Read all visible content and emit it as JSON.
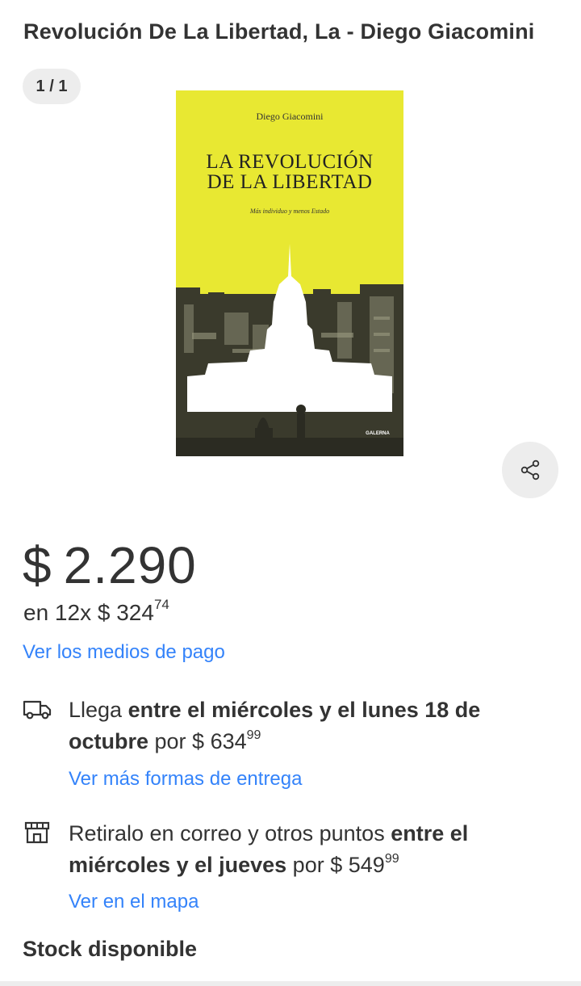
{
  "product": {
    "title": "Revolución De La Libertad, La - Diego Giacomini",
    "gallery_counter": "1 / 1"
  },
  "cover": {
    "author": "Diego Giacomini",
    "title_line1": "LA REVOLUCIÓN",
    "title_line2": "DE LA LIBERTAD",
    "subtitle": "Más individuo y menos Estado",
    "publisher": "GALERNA",
    "bg_color": "#e8e832"
  },
  "share": {
    "icon": "share-icon"
  },
  "price": {
    "currency": "$",
    "amount": "2.290"
  },
  "installments": {
    "prefix": "en 12x",
    "currency": "$",
    "amount": "324",
    "cents": "74"
  },
  "payment_link": "Ver los medios de pago",
  "shipping": {
    "icon": "truck-icon",
    "lead": "Llega ",
    "bold": "entre el miércoles y el lunes 18 de octubre",
    "mid": " por ",
    "currency": "$",
    "amount": "634",
    "cents": "99",
    "link": "Ver más formas de entrega"
  },
  "pickup": {
    "icon": "store-icon",
    "lead": "Retiralo en correo y otros puntos ",
    "bold": "entre el miércoles y el jueves",
    "mid": " por ",
    "currency": "$",
    "amount": "549",
    "cents": "99",
    "link": "Ver en el mapa"
  },
  "stock": "Stock disponible",
  "colors": {
    "link": "#3483fa",
    "text": "#333333",
    "chip": "#ededed"
  }
}
